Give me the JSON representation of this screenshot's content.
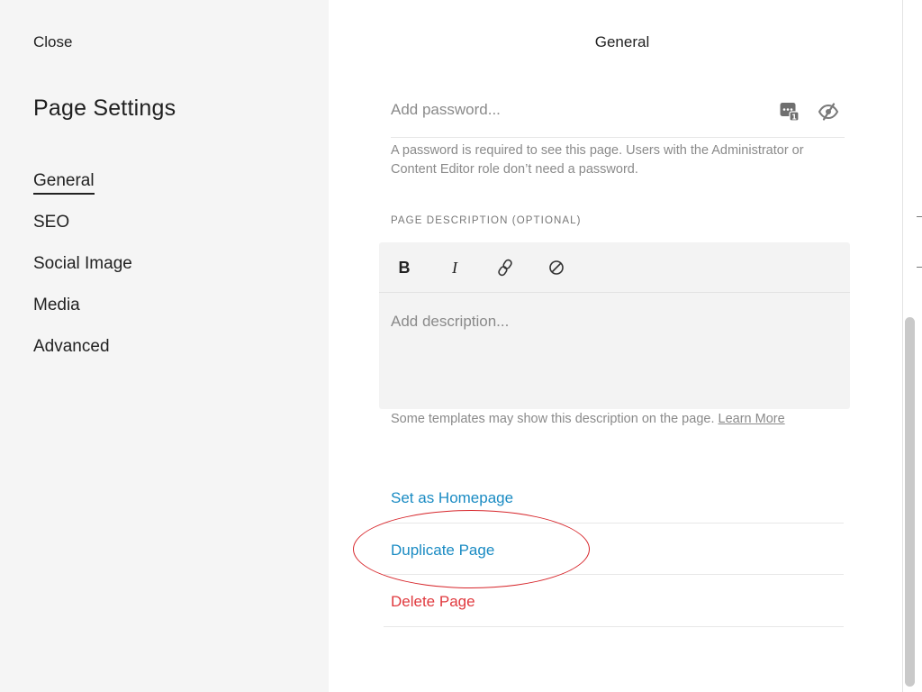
{
  "sidebar": {
    "close_label": "Close",
    "title": "Page Settings",
    "items": [
      {
        "label": "General",
        "active": true
      },
      {
        "label": "SEO"
      },
      {
        "label": "Social Image"
      },
      {
        "label": "Media"
      },
      {
        "label": "Advanced"
      }
    ]
  },
  "main": {
    "title": "General",
    "password": {
      "placeholder": "Add password...",
      "value": "",
      "help": "A password is required to see this page. Users with the Administrator or Content Editor role don’t need a password.",
      "icons": [
        "password-manager-icon",
        "eye-slash-icon"
      ]
    },
    "description": {
      "label": "PAGE DESCRIPTION (OPTIONAL)",
      "toolbar": {
        "bold": "B",
        "italic": "I",
        "link_icon": "link-icon",
        "clear_icon": "clear-format-icon"
      },
      "placeholder": "Add description...",
      "value": "",
      "help": "Some templates may show this description on the page.",
      "learn_more": "Learn More"
    },
    "actions": {
      "set_homepage": "Set as Homepage",
      "duplicate": "Duplicate Page",
      "delete": "Delete Page"
    }
  },
  "colors": {
    "sidebar_bg": "#f5f5f5",
    "link_blue": "#1a8bc3",
    "danger_red": "#e0393e",
    "annotation_red": "#d7262b"
  }
}
